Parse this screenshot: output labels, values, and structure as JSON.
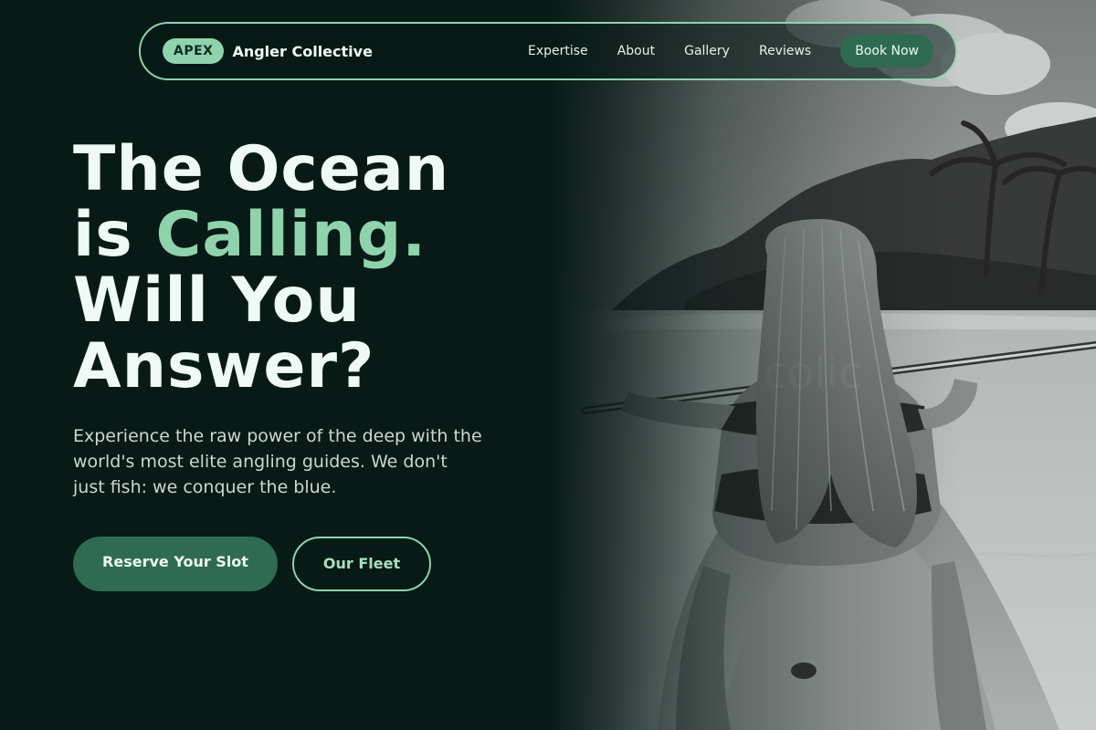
{
  "nav": {
    "badge": "APEX",
    "brand_name": "Angler Collective",
    "links": [
      "Expertise",
      "About",
      "Gallery",
      "Reviews"
    ],
    "cta": "Book Now"
  },
  "hero": {
    "headline_line1": "The Ocean",
    "headline_line2_start": "is ",
    "headline_line2_accent": "Calling.",
    "headline_line3": "Will You",
    "headline_line4": "Answer?",
    "lede": "Experience the raw power of the deep with the world's most elite angling guides. We don't just fish: we conquer the blue.",
    "primary_button": "Reserve Your Slot",
    "secondary_button": "Our Fleet"
  },
  "colors": {
    "background": "#071a16",
    "accent": "#8fd3ac",
    "button": "#2e6b52",
    "text": "#eefaf3"
  }
}
